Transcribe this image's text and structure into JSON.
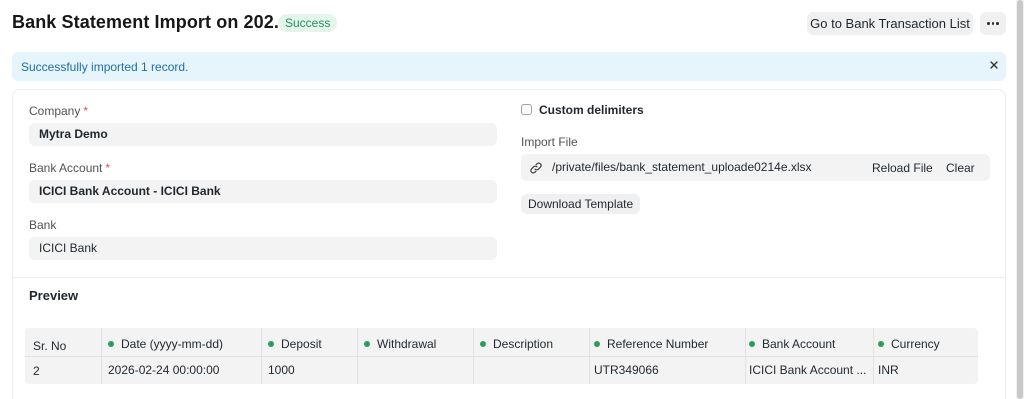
{
  "header": {
    "title": "Bank Statement Import on 202...",
    "status": "Success",
    "go_button": "Go to Bank Transaction List",
    "more_icon": "more-horizontal-icon"
  },
  "alert": {
    "message": "Successfully imported 1 record.",
    "close_icon": "close-icon"
  },
  "form": {
    "company": {
      "label": "Company",
      "value": "Mytra Demo",
      "required": "*"
    },
    "bank_account": {
      "label": "Bank Account",
      "value": "ICICI Bank Account - ICICI Bank",
      "required": "*"
    },
    "bank": {
      "label": "Bank",
      "value": "ICICI Bank"
    },
    "custom_delimiters": {
      "label": "Custom delimiters",
      "checked": false
    },
    "import_file": {
      "label": "Import File",
      "path": "/private/files/bank_statement_uploade0214e.xlsx",
      "reload_label": "Reload File",
      "clear_label": "Clear",
      "icon": "link-icon"
    },
    "download_template": "Download Template"
  },
  "preview": {
    "title": "Preview",
    "columns": [
      "Sr. No",
      "Date (yyyy-mm-dd)",
      "Deposit",
      "Withdrawal",
      "Description",
      "Reference Number",
      "Bank Account",
      "Currency"
    ],
    "rows": [
      [
        "2",
        "2026-02-24 00:00:00",
        "1000",
        "",
        "",
        "UTR349066",
        "ICICI Bank Account ...",
        "INR"
      ]
    ]
  },
  "colors": {
    "accent_success": "#278f5e",
    "alert_bg": "#e6f4fb",
    "alert_text": "#1e6fa0",
    "required": "#e24c4c"
  }
}
